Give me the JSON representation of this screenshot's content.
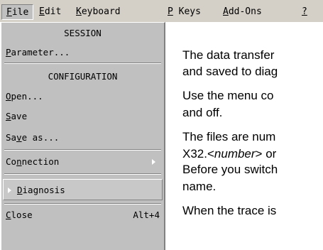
{
  "menubar": {
    "items": [
      {
        "accel": "F",
        "rest": "ile"
      },
      {
        "accel": "E",
        "rest": "dit"
      },
      {
        "accel": "K",
        "rest": "eyboard"
      },
      {
        "accel": "P",
        "rest": " Keys"
      },
      {
        "accel": "A",
        "rest": "dd-Ons"
      },
      {
        "accel": "?",
        "rest": ""
      }
    ]
  },
  "file_menu": {
    "session_header": "SESSION",
    "parameter": {
      "accel": "P",
      "rest": "arameter..."
    },
    "configuration_header": "CONFIGURATION",
    "open": {
      "accel": "O",
      "rest": "pen..."
    },
    "save": {
      "accel": "S",
      "rest": "ave"
    },
    "save_as": {
      "pre": "Sa",
      "accel": "v",
      "rest": "e as..."
    },
    "connection": {
      "pre": "Co",
      "accel": "n",
      "rest": "nection"
    },
    "diagnosis": {
      "accel": "D",
      "rest": "iagnosis"
    },
    "close": {
      "accel": "C",
      "rest": "lose",
      "shortcut": "Alt+4"
    }
  },
  "content": {
    "line1": "The data transfer",
    "line2": "and saved to diag",
    "line3": "Use the menu co",
    "line4": "and off.",
    "line5": "The files are num",
    "line6_pre": "X32.<",
    "line6_italic": "number",
    "line6_post": "> or",
    "line7": "Before you switch",
    "line8": "name.",
    "line9": "When the trace is"
  }
}
